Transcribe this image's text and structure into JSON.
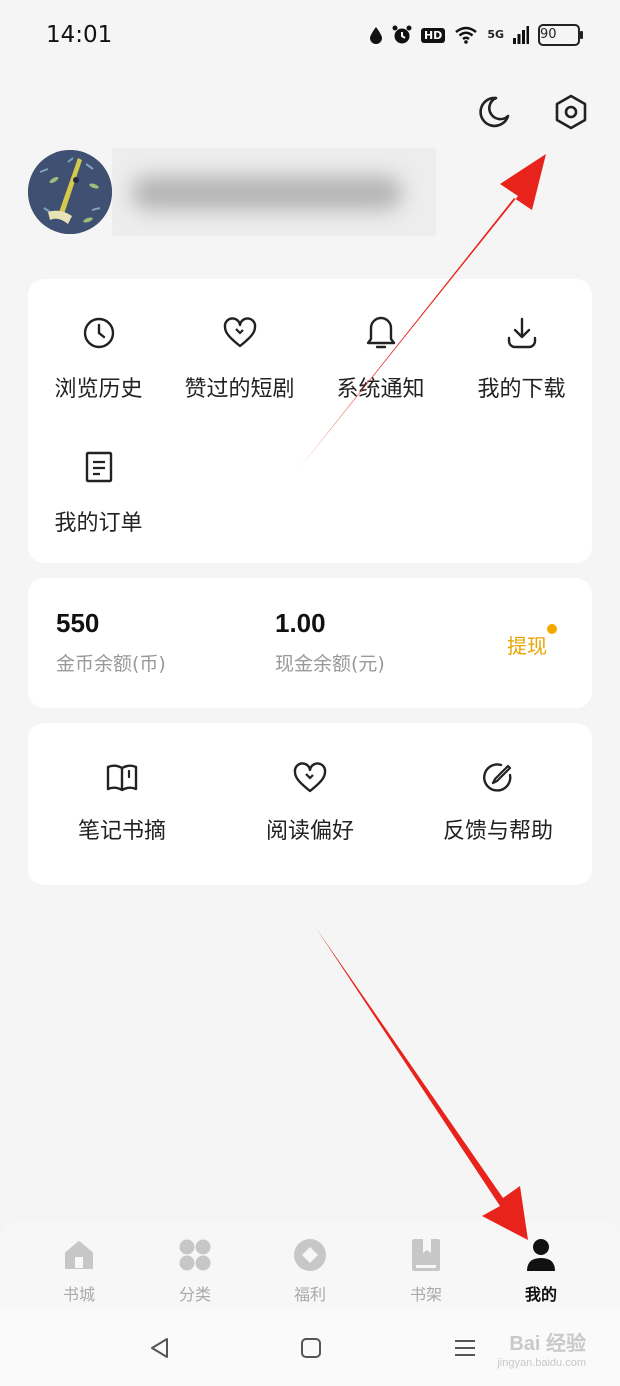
{
  "status_bar": {
    "time": "14:01",
    "battery": "90",
    "network": "5G",
    "hd": "HD"
  },
  "header": {
    "night_mode_icon": "moon-icon",
    "settings_icon": "settings-hexagon-icon"
  },
  "profile": {
    "username": ""
  },
  "quick_actions": [
    {
      "label": "浏览历史",
      "icon": "clock-icon"
    },
    {
      "label": "赞过的短剧",
      "icon": "heart-icon"
    },
    {
      "label": "系统通知",
      "icon": "bell-icon"
    },
    {
      "label": "我的下载",
      "icon": "download-icon"
    },
    {
      "label": "我的订单",
      "icon": "order-icon"
    }
  ],
  "wallet": {
    "coins_value": "550",
    "coins_label": "金币余额(币)",
    "cash_value": "1.00",
    "cash_label": "现金余额(元)",
    "withdraw_label": "提现",
    "accent_color": "#e8a400"
  },
  "tools": [
    {
      "label": "笔记书摘",
      "icon": "book-open-icon"
    },
    {
      "label": "阅读偏好",
      "icon": "heart-icon"
    },
    {
      "label": "反馈与帮助",
      "icon": "pencil-circle-icon"
    }
  ],
  "tab_bar": {
    "tabs": [
      {
        "label": "书城",
        "icon": "home-icon"
      },
      {
        "label": "分类",
        "icon": "category-icon"
      },
      {
        "label": "福利",
        "icon": "welfare-icon"
      },
      {
        "label": "书架",
        "icon": "bookshelf-icon"
      },
      {
        "label": "我的",
        "icon": "person-icon"
      }
    ],
    "active": "我的"
  },
  "watermark": {
    "text": "Bai 经验",
    "sub": "jingyan.baidu.com"
  }
}
